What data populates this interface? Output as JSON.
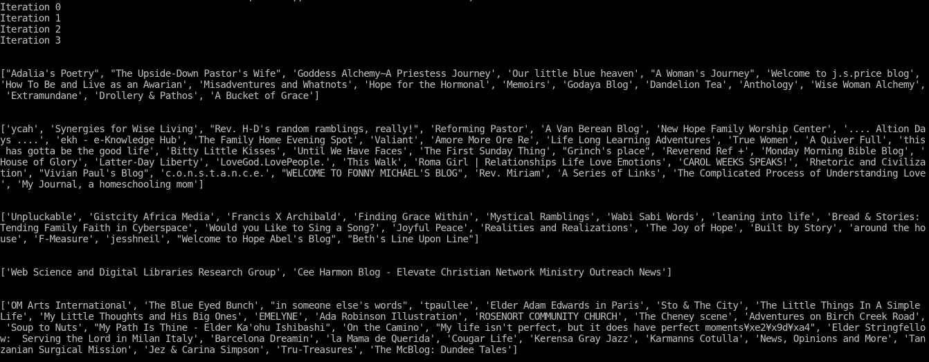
{
  "console": {
    "top_fragment": "                                             ,       ,,                              ,",
    "iterations": [
      "Iteration 0",
      "Iteration 1",
      "Iteration 2",
      "Iteration 3"
    ],
    "blocks": [
      [
        "[\"Adalia's Poetry\", \"The Upside-Down Pastor's Wife\", 'Goddess Alchemy~A Priestess Journey', 'Our little blue heaven', \"A Woman's Journey\", 'Welcome to j.s.price blog',",
        "'How To Be and Live as an Awarian', 'Misadventures and Whatnots', 'Hope for the Hormonal', 'Memoirs', 'Godaya Blog', 'Dandelion Tea', 'Anthology', 'Wise Woman Alchemy',",
        " 'Extramundane', 'Drollery & Pathos', 'A Bucket of Grace']"
      ],
      [
        "['ycah', 'Synergies for Wise Living', \"Rev. H-D's random ramblings, really!\", 'Reforming Pastor', 'A Van Berean Blog', 'New Hope Family Worship Center', '.... Altion Da",
        "ys ....', 'ekh - e-Knowledge Hub', 'The Family Home Evening Spot', 'Valiant', 'Amore More Ore Re', 'Life Long Learning Adventures', 'True Women', 'A Quiver Full', 'this",
        " has gotta be the good life', 'Bitty Little Kisses', 'Until We Have Faces', 'The First Sunday Thing', \"Grinch's place\", 'Reverend Ref +', 'Monday Morning Bible Blog', '",
        "House of Glory', 'Latter-Day Liberty', 'LoveGod.LovePeople.', 'This Walk', 'Roma Girl | Relationships Life Love Emotions', 'CAROL WEEKS SPEAKS!', 'Rhetoric and Civiliza",
        "tion', \"Vivian Paul's Blog\", 'c.o.n.s.t.a.n.c.e.', \"WELCOME TO FONNY MICHAEL'S BLOG\", 'Rev. Miriam', 'A Series of Links', 'The Complicated Process of Understanding Love",
        "', 'My Journal, a homeschooling mom']"
      ],
      [
        "['Unpluckable', 'Gistcity Africa Media', 'Francis X Archibald', 'Finding Grace Within', 'Mystical Ramblings', 'Wabi Sabi Words', 'leaning into life', 'Bread & Stories:",
        "Tending Family Faith in Cyberspace', 'Would you Like to Sing a Song?', 'Joyful Peace', 'Realities and Realizations', 'The Joy of Hope', 'Built by Story', 'around the ho",
        "use', 'F-Measure', 'jesshneil', \"Welcome to Hope Abel's Blog\", \"Beth's Line Upon Line\"]"
      ],
      [
        "['Web Science and Digital Libraries Research Group', 'Cee Harmon Blog - Elevate Christian Network Ministry Outreach News']"
      ],
      [
        "['OM Arts International', 'The Blue Eyed Bunch', \"in someone else's words\", 'tpaullee', 'Elder Adam Edwards in Paris', 'Sto & The City', 'The Little Things In A Simple",
        "Life', 'My Little Thoughts and His Big Ones', 'EMELYNE', 'Ada Robinson Illustration', 'ROSENORT COMMUNITY CHURCH', 'The Cheney scene', 'Adventures on Birch Creek Road',",
        " 'Soup to Nuts', \"My Path Is Thine - Elder Ka'ohu Ishibashi\", 'On the Camino', \"My life isn't perfect, but it does have perfect moments¥xe2¥x9d¥xa4\", 'Elder Stringfello",
        "w:  Serving the Lord in Milan Italy', 'Barcelona Dreamin', 'la Mama de Querida', 'Cougar Life', 'Kerensa Gray Jazz', 'Karmanns Cotulla', 'News, Opinions and More', 'Tan",
        "zanian Surgical Mission', 'Jez & Carina Simpson', 'Tru-Treasures', 'The McBlog: Dundee Tales']"
      ]
    ]
  }
}
